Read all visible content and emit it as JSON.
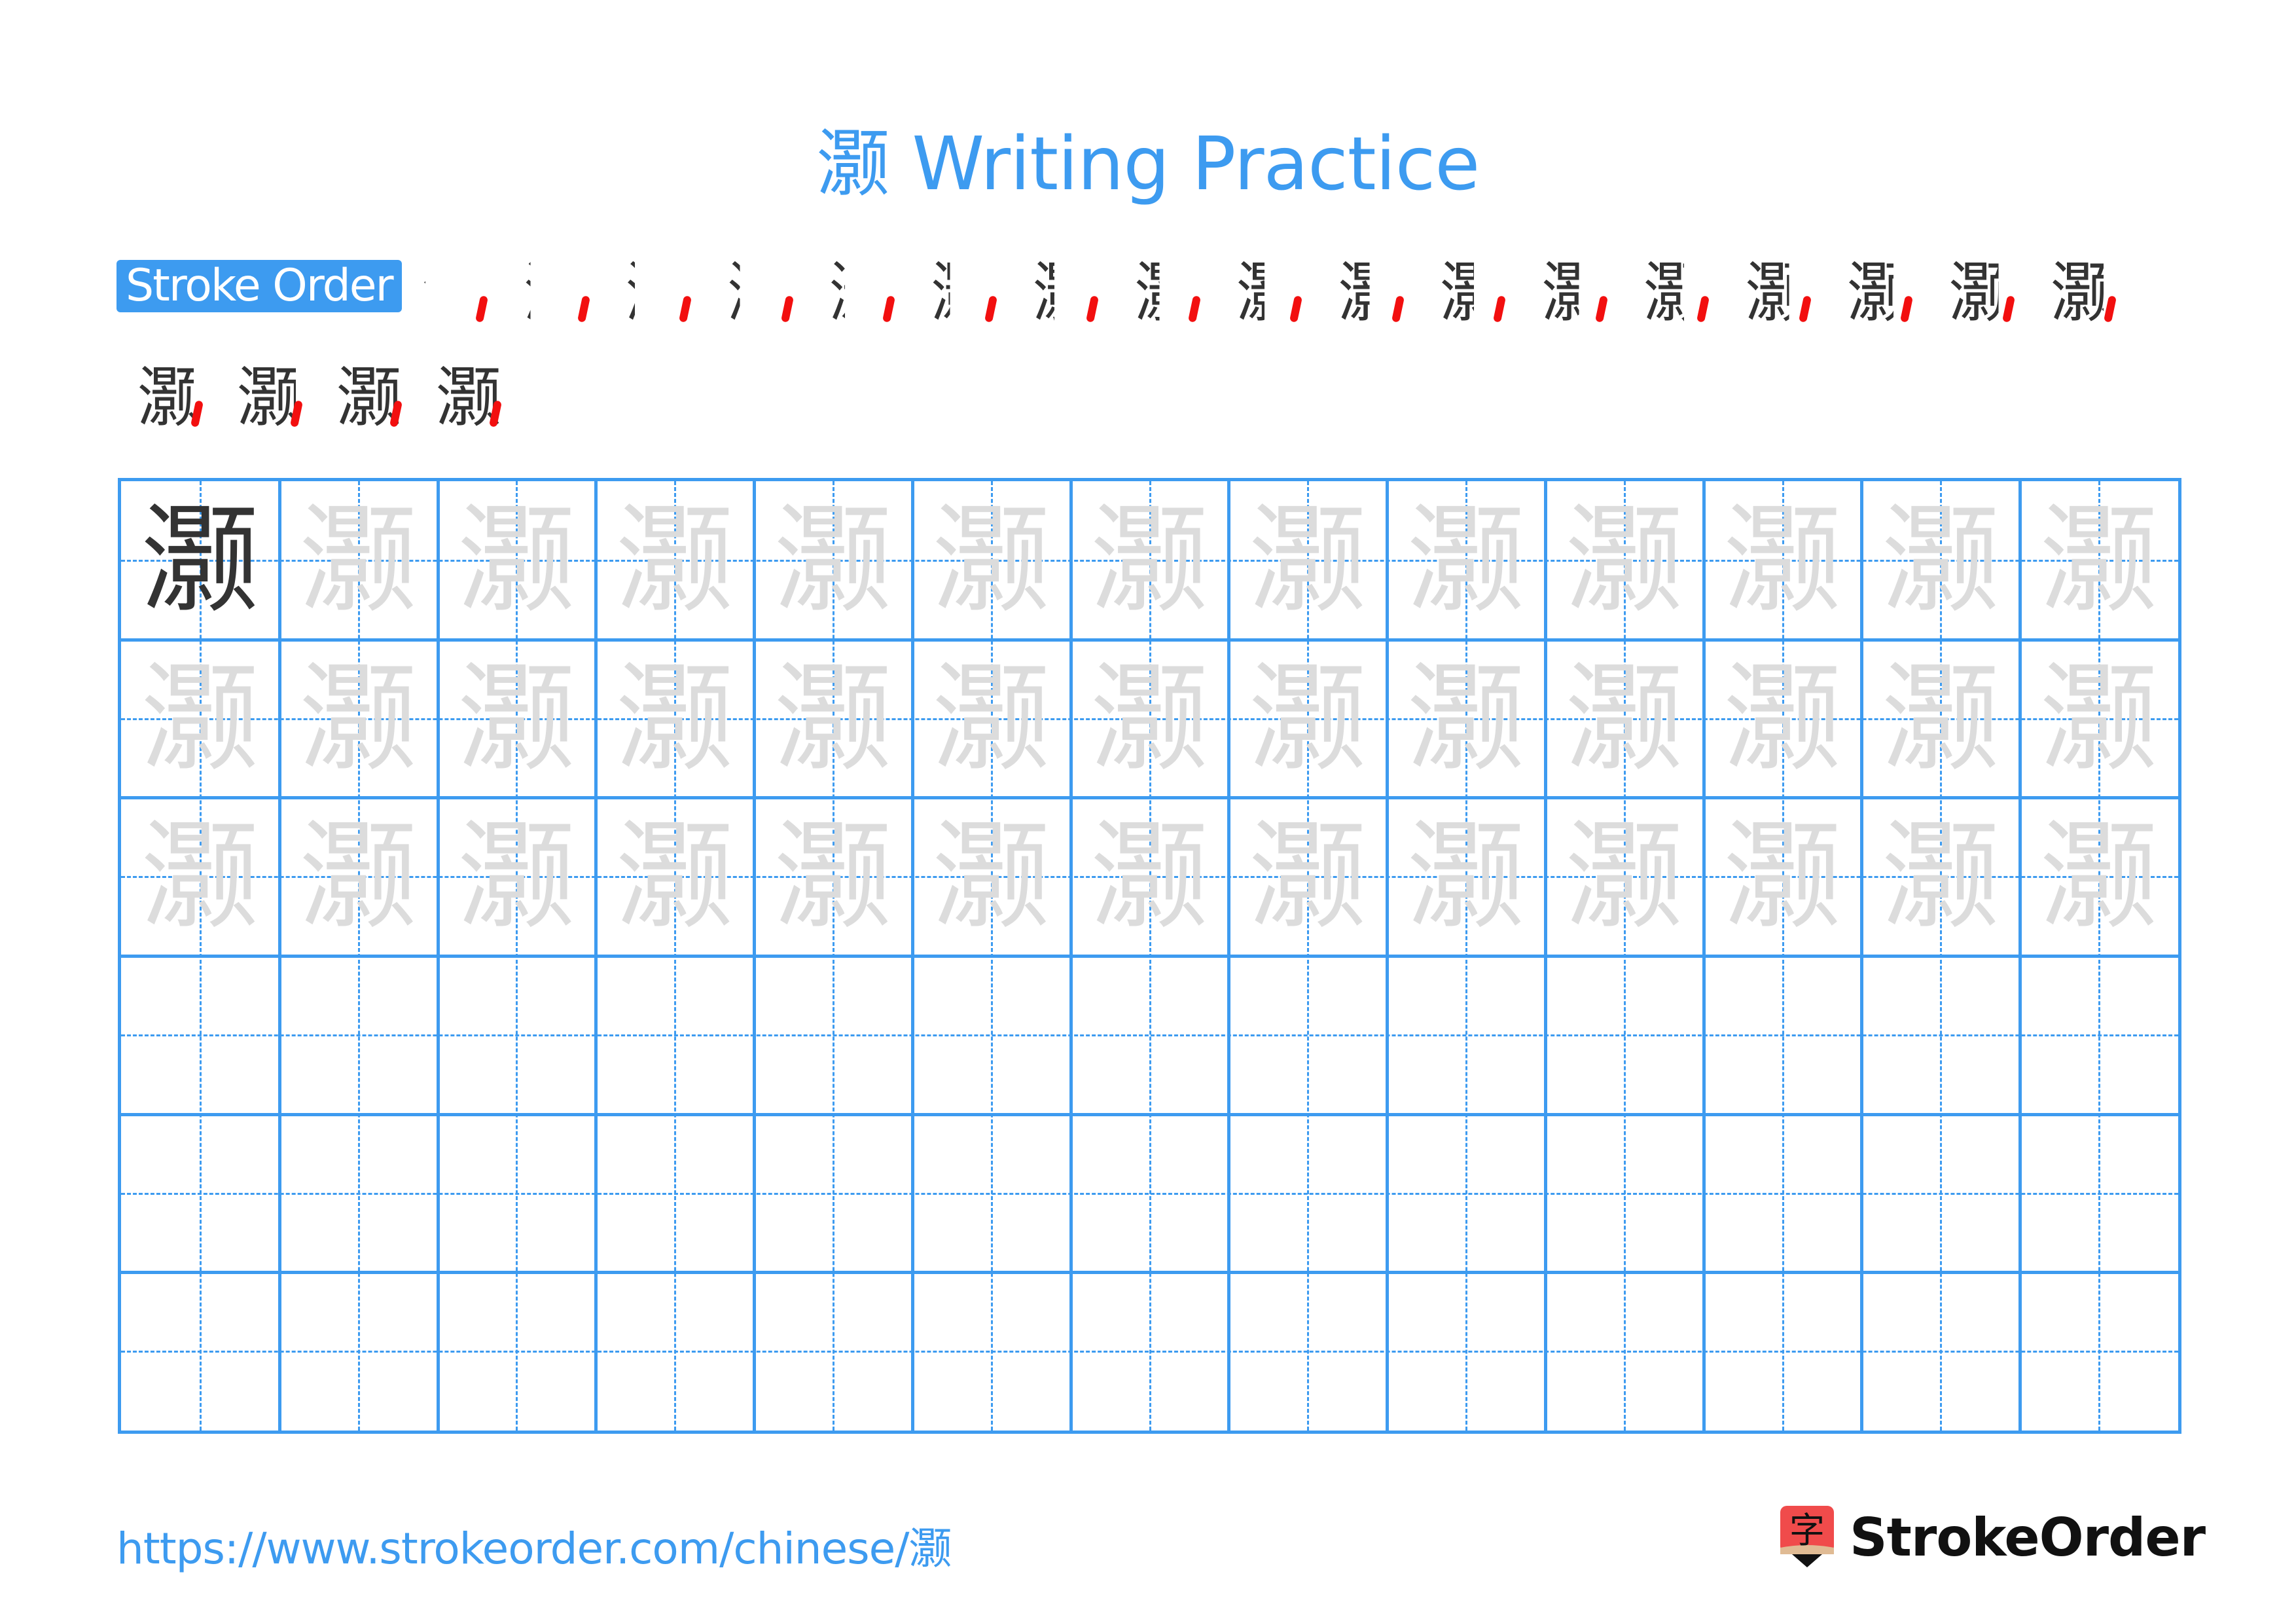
{
  "title": "灏 Writing Practice",
  "character": "灏",
  "stroke_order": {
    "label": "Stroke Order",
    "stroke_count": 21,
    "steps": [
      1,
      2,
      3,
      4,
      5,
      6,
      7,
      8,
      9,
      10,
      11,
      12,
      13,
      14,
      15,
      16,
      17,
      18,
      19,
      20,
      21
    ],
    "row1_count": 17,
    "row2_count": 4,
    "highlight_color": "#f20f0f",
    "drawn_color": "#333333"
  },
  "practice_grid": {
    "columns": 13,
    "rows": 6,
    "model_cells": 1,
    "trace_rows": 3,
    "empty_rows": 3,
    "line_color": "#3d9bf0",
    "model_color": "#333333",
    "trace_color": "#dcdcdc"
  },
  "footer": {
    "url": "https://www.strokeorder.com/chinese/灏",
    "logo_text": "StrokeOrder",
    "logo_glyph": "字"
  }
}
